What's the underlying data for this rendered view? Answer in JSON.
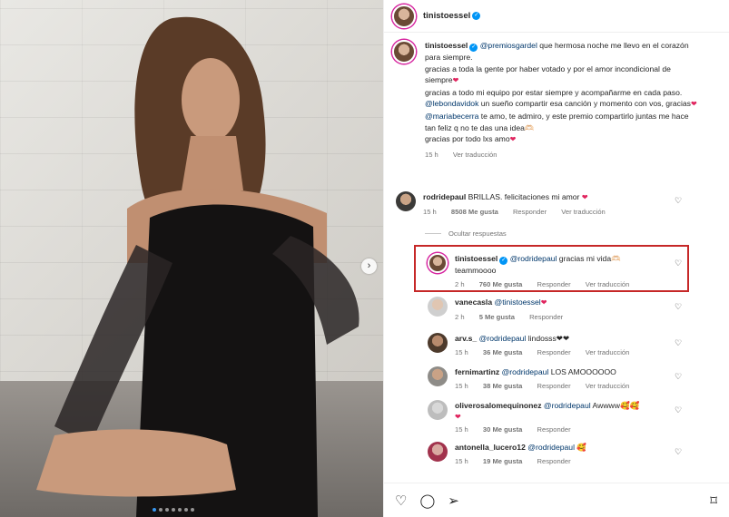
{
  "colors": {
    "accent": "#0095f6",
    "link": "#00376b",
    "heart": "#e0245e",
    "highlight_border": "#c62828"
  },
  "photo": {
    "carousel_total": 7,
    "carousel_active": 1,
    "next_icon": "chevron-right-icon",
    "next_glyph": "›"
  },
  "header": {
    "username": "tinistoessel",
    "verified_icon": "verified-badge-icon",
    "verified_glyph": "✓"
  },
  "caption": {
    "username": "tinistoessel",
    "mention": "@premiosgardel",
    "line1_rest": " que hermosa noche me llevo en el corazón para siempre.",
    "line2": "gracias a toda la gente por haber votado y por el amor incondicional de siempre",
    "line3": "gracias a todo mi equipo por estar siempre y acompañarme en cada paso.",
    "line4_mention": "@lebondavidok",
    "line4_rest": " un sueño compartir esa canción y momento con vos, gracias",
    "line5_mention": "@mariabecerra",
    "line5_rest": " te amo, te admiro, y este premio compartirlo juntas me hace tan feliz q no te das una idea🫶🏻",
    "line6": "gracias por todo lxs amo",
    "heart_glyph": "❤",
    "time": "15 h",
    "see_translation": "Ver traducción"
  },
  "comments": [
    {
      "username": "rodridepaul",
      "text": " BRILLAS. felicitaciones mi amor ",
      "emoji": "❤",
      "time": "15 h",
      "likes": "8508 Me gusta",
      "reply": "Responder",
      "translate": "Ver traducción"
    }
  ],
  "hide_replies": "Ocultar respuestas",
  "replies": [
    {
      "username": "tinistoessel",
      "mention": "@rodridepaul",
      "text": " gracias mi vida🫶🏻",
      "text2": "teammoooo",
      "time": "2 h",
      "likes": "760 Me gusta",
      "reply": "Responder",
      "translate": "Ver traducción"
    },
    {
      "username": "vanecasla",
      "mention": "@tinistoessel",
      "text": " ❤",
      "time": "2 h",
      "likes": "5 Me gusta",
      "reply": "Responder"
    },
    {
      "username": "arv.s_",
      "mention": "@rodridepaul",
      "text": " lindosss❤❤",
      "time": "15 h",
      "likes": "36 Me gusta",
      "reply": "Responder",
      "translate": "Ver traducción"
    },
    {
      "username": "fernimartinz",
      "mention": "@rodridepaul",
      "text": " LOS AMOOOOOO",
      "time": "15 h",
      "likes": "38 Me gusta",
      "reply": "Responder",
      "translate": "Ver traducción"
    },
    {
      "username": "oliverosalomequinonez",
      "mention": "@rodridepaul",
      "text": " Awwww🥰🥰",
      "text2": "❤",
      "time": "15 h",
      "likes": "30 Me gusta",
      "reply": "Responder"
    },
    {
      "username": "antonella_lucero12",
      "mention": "@rodridepaul",
      "text": " 🥰",
      "time": "15 h",
      "likes": "19 Me gusta",
      "reply": "Responder"
    }
  ],
  "actions": {
    "like_icon": "heart-icon",
    "comment_icon": "comment-icon",
    "share_icon": "share-icon",
    "save_icon": "bookmark-icon",
    "like_glyph": "♡",
    "comment_glyph": "◯",
    "share_glyph": "➢",
    "save_glyph": "⌑",
    "comment_like_glyph": "♡"
  }
}
